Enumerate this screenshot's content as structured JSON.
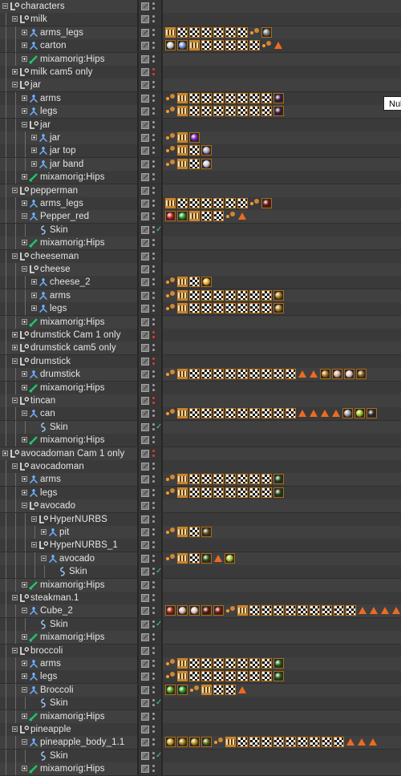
{
  "tooltip": "Nul",
  "colors": {
    "tag_checker_border": "#c47a18",
    "visibility_red": "#e23b2b",
    "enabled_check": "#33d39a",
    "null_icon": "#f2f2f2",
    "joint_icon": "#6fb0ff",
    "bone_icon": "#22c46a",
    "skin_icon": "#9fc9ff"
  },
  "rows": [
    {
      "label": "characters",
      "depth": 0,
      "icon": "null-icon",
      "expand": "open",
      "vis": "none",
      "check": false,
      "tags": ""
    },
    {
      "label": "milk",
      "depth": 1,
      "icon": "null-icon",
      "expand": "open",
      "vis": "none",
      "check": false,
      "tags": ""
    },
    {
      "label": "arms_legs",
      "depth": 2,
      "icon": "joint-icon",
      "expand": "closed",
      "vis": "none",
      "check": false,
      "tags": "t c c c c c c k m:#7a7a7a"
    },
    {
      "label": "carton",
      "depth": 2,
      "icon": "joint-icon",
      "expand": "closed",
      "vis": "none",
      "check": false,
      "tags": "m:#cfcfcf m:#6e8fd6 t c c c c c k A"
    },
    {
      "label": "mixamorig:Hips",
      "depth": 2,
      "icon": "bone-icon",
      "expand": "closed",
      "vis": "none",
      "check": false,
      "tags": ""
    },
    {
      "label": "milk cam5 only",
      "depth": 1,
      "icon": "null-icon",
      "expand": "closed",
      "vis": "red",
      "check": false,
      "tags": ""
    },
    {
      "label": "jar",
      "depth": 1,
      "icon": "null-icon",
      "expand": "open",
      "vis": "none",
      "check": false,
      "tags": ""
    },
    {
      "label": "arms",
      "depth": 2,
      "icon": "joint-icon",
      "expand": "closed",
      "vis": "none",
      "check": false,
      "tags": "k t c c c c c c c m:#3a1a50"
    },
    {
      "label": "legs",
      "depth": 2,
      "icon": "joint-icon",
      "expand": "closed",
      "vis": "none",
      "check": false,
      "tags": "k t c c c c c c c m:#3a1a50"
    },
    {
      "label": "jar",
      "depth": 2,
      "icon": "null-icon",
      "expand": "open",
      "vis": "none",
      "check": false,
      "tags": ""
    },
    {
      "label": "jar",
      "depth": 3,
      "icon": "joint-icon",
      "expand": "closed",
      "vis": "none",
      "check": false,
      "tags": "k t m:#7b24c9"
    },
    {
      "label": "jar top",
      "depth": 3,
      "icon": "joint-icon",
      "expand": "closed",
      "vis": "none",
      "check": false,
      "tags": "k t c m:#b3a0c6"
    },
    {
      "label": "jar band",
      "depth": 3,
      "icon": "joint-icon",
      "expand": "closed",
      "vis": "none",
      "check": false,
      "tags": "k t c m:#d0c6d8"
    },
    {
      "label": "mixamorig:Hips",
      "depth": 2,
      "icon": "bone-icon",
      "expand": "closed",
      "vis": "none",
      "check": false,
      "tags": ""
    },
    {
      "label": "pepperman",
      "depth": 1,
      "icon": "null-icon",
      "expand": "open",
      "vis": "none",
      "check": false,
      "tags": ""
    },
    {
      "label": "arms_legs",
      "depth": 2,
      "icon": "joint-icon",
      "expand": "closed",
      "vis": "none",
      "check": false,
      "tags": "t c c c c c c k m:#7a0c12"
    },
    {
      "label": "Pepper_red",
      "depth": 2,
      "icon": "joint-icon",
      "expand": "open",
      "vis": "none",
      "check": false,
      "tags": "m:#d81c1c m:#21a021 t c c k A"
    },
    {
      "label": "Skin",
      "depth": 3,
      "icon": "skin-icon",
      "expand": "none",
      "vis": "none",
      "check": true,
      "tags": ""
    },
    {
      "label": "mixamorig:Hips",
      "depth": 2,
      "icon": "bone-icon",
      "expand": "closed",
      "vis": "none",
      "check": false,
      "tags": ""
    },
    {
      "label": "cheeseman",
      "depth": 1,
      "icon": "null-icon",
      "expand": "open",
      "vis": "none",
      "check": false,
      "tags": ""
    },
    {
      "label": "cheese",
      "depth": 2,
      "icon": "null-icon",
      "expand": "open",
      "vis": "none",
      "check": false,
      "tags": ""
    },
    {
      "label": "cheese_2",
      "depth": 3,
      "icon": "joint-icon",
      "expand": "closed",
      "vis": "none",
      "check": false,
      "tags": "k t c m:#f0b020"
    },
    {
      "label": "arms",
      "depth": 3,
      "icon": "joint-icon",
      "expand": "closed",
      "vis": "none",
      "check": false,
      "tags": "k t c c c c c c c m:#a8781a"
    },
    {
      "label": "legs",
      "depth": 3,
      "icon": "joint-icon",
      "expand": "closed",
      "vis": "none",
      "check": false,
      "tags": "k t c c c c c c c m:#a8781a"
    },
    {
      "label": "mixamorig:Hips",
      "depth": 2,
      "icon": "bone-icon",
      "expand": "closed",
      "vis": "none",
      "check": false,
      "tags": ""
    },
    {
      "label": "drumstick Cam 1 only",
      "depth": 1,
      "icon": "null-icon",
      "expand": "closed",
      "vis": "red",
      "check": false,
      "tags": ""
    },
    {
      "label": "drumstick cam5 only",
      "depth": 1,
      "icon": "null-icon",
      "expand": "closed",
      "vis": "none",
      "check": false,
      "tags": ""
    },
    {
      "label": "drumstick",
      "depth": 1,
      "icon": "null-icon",
      "expand": "open",
      "vis": "red",
      "check": false,
      "tags": ""
    },
    {
      "label": "drumstick",
      "depth": 2,
      "icon": "joint-icon",
      "expand": "closed",
      "vis": "none",
      "check": false,
      "tags": "k t c c c c c c c c c A A m:#b07010 m:#d8a898 m:#e6c8c8 m:#8a5a10"
    },
    {
      "label": "mixamorig:Hips",
      "depth": 2,
      "icon": "bone-icon",
      "expand": "closed",
      "vis": "none",
      "check": false,
      "tags": ""
    },
    {
      "label": "tincan",
      "depth": 1,
      "icon": "null-icon",
      "expand": "open",
      "vis": "red",
      "check": false,
      "tags": ""
    },
    {
      "label": "can",
      "depth": 2,
      "icon": "joint-icon",
      "expand": "open",
      "vis": "none",
      "check": false,
      "tags": "k t c c c c c c c c c A A A A m:#9c9c9c m:#9cc820 m:#2c2c2c"
    },
    {
      "label": "Skin",
      "depth": 3,
      "icon": "skin-icon",
      "expand": "none",
      "vis": "none",
      "check": true,
      "tags": ""
    },
    {
      "label": "mixamorig:Hips",
      "depth": 2,
      "icon": "bone-icon",
      "expand": "closed",
      "vis": "none",
      "check": false,
      "tags": ""
    },
    {
      "label": "avocadoman Cam 1 only",
      "depth": 0,
      "icon": "null-icon",
      "expand": "closed",
      "vis": "red",
      "check": false,
      "tags": ""
    },
    {
      "label": "avocadoman",
      "depth": 1,
      "icon": "null-icon",
      "expand": "open",
      "vis": "none",
      "check": false,
      "tags": ""
    },
    {
      "label": "arms",
      "depth": 2,
      "icon": "joint-icon",
      "expand": "closed",
      "vis": "none",
      "check": false,
      "tags": "k t c c c c c c c m:#1c4a1c"
    },
    {
      "label": "legs",
      "depth": 2,
      "icon": "joint-icon",
      "expand": "closed",
      "vis": "none",
      "check": false,
      "tags": "k t c c c c c c c m:#1c4a1c"
    },
    {
      "label": "avocado",
      "depth": 2,
      "icon": "null-icon",
      "expand": "open",
      "vis": "none",
      "check": false,
      "tags": ""
    },
    {
      "label": "HyperNURBS",
      "depth": 3,
      "icon": "null-icon",
      "expand": "open",
      "vis": "none",
      "check": false,
      "tags": ""
    },
    {
      "label": "pit",
      "depth": 4,
      "icon": "joint-icon",
      "expand": "closed",
      "vis": "none",
      "check": false,
      "tags": "k t c m:#5a4a10"
    },
    {
      "label": "HyperNURBS_1",
      "depth": 3,
      "icon": "null-icon",
      "expand": "open",
      "vis": "none",
      "check": false,
      "tags": ""
    },
    {
      "label": "avocado",
      "depth": 4,
      "icon": "joint-icon",
      "expand": "open",
      "vis": "none",
      "check": false,
      "tags": "k t c m:#2e5a10 A m:#a8c820"
    },
    {
      "label": "Skin",
      "depth": 5,
      "icon": "skin-icon",
      "expand": "none",
      "vis": "none",
      "check": true,
      "tags": ""
    },
    {
      "label": "mixamorig:Hips",
      "depth": 2,
      "icon": "bone-icon",
      "expand": "closed",
      "vis": "none",
      "check": false,
      "tags": ""
    },
    {
      "label": "steakman.1",
      "depth": 1,
      "icon": "null-icon",
      "expand": "open",
      "vis": "none",
      "check": false,
      "tags": ""
    },
    {
      "label": "Cube_2",
      "depth": 2,
      "icon": "joint-icon",
      "expand": "open",
      "vis": "none",
      "check": false,
      "tags": "m:#b02010 m:#d8b8b0 m:#e0c8c0 m:#701010 m:#8a1010 k t c c c c c c c c c A A A A A"
    },
    {
      "label": "Skin",
      "depth": 3,
      "icon": "skin-icon",
      "expand": "none",
      "vis": "none",
      "check": true,
      "tags": ""
    },
    {
      "label": "mixamorig:Hips",
      "depth": 2,
      "icon": "bone-icon",
      "expand": "closed",
      "vis": "none",
      "check": false,
      "tags": ""
    },
    {
      "label": "broccoli",
      "depth": 1,
      "icon": "null-icon",
      "expand": "open",
      "vis": "none",
      "check": false,
      "tags": ""
    },
    {
      "label": "arms",
      "depth": 2,
      "icon": "joint-icon",
      "expand": "closed",
      "vis": "none",
      "check": false,
      "tags": "k t c c c c c c c m:#1c6a1c"
    },
    {
      "label": "legs",
      "depth": 2,
      "icon": "joint-icon",
      "expand": "closed",
      "vis": "none",
      "check": false,
      "tags": "k t c c c c c c c m:#1c6a1c"
    },
    {
      "label": "Broccoli",
      "depth": 2,
      "icon": "joint-icon",
      "expand": "open",
      "vis": "none",
      "check": false,
      "tags": "m:#4aa010 m:#20a020 k t c c A"
    },
    {
      "label": "Skin",
      "depth": 3,
      "icon": "skin-icon",
      "expand": "none",
      "vis": "none",
      "check": true,
      "tags": ""
    },
    {
      "label": "mixamorig:Hips",
      "depth": 2,
      "icon": "bone-icon",
      "expand": "closed",
      "vis": "none",
      "check": false,
      "tags": ""
    },
    {
      "label": "pineapple",
      "depth": 1,
      "icon": "null-icon",
      "expand": "open",
      "vis": "none",
      "check": false,
      "tags": ""
    },
    {
      "label": "pineapple_body_1.1",
      "depth": 2,
      "icon": "joint-icon",
      "expand": "open",
      "vis": "none",
      "check": false,
      "tags": "m:#c8a010 m:#a88010 m:#b89010 m:#606a10 k t c c c c c c c c c A A A"
    },
    {
      "label": "Skin",
      "depth": 3,
      "icon": "skin-icon",
      "expand": "none",
      "vis": "none",
      "check": true,
      "tags": ""
    },
    {
      "label": "mixamorig:Hips",
      "depth": 2,
      "icon": "bone-icon",
      "expand": "closed",
      "vis": "none",
      "check": false,
      "tags": ""
    }
  ]
}
